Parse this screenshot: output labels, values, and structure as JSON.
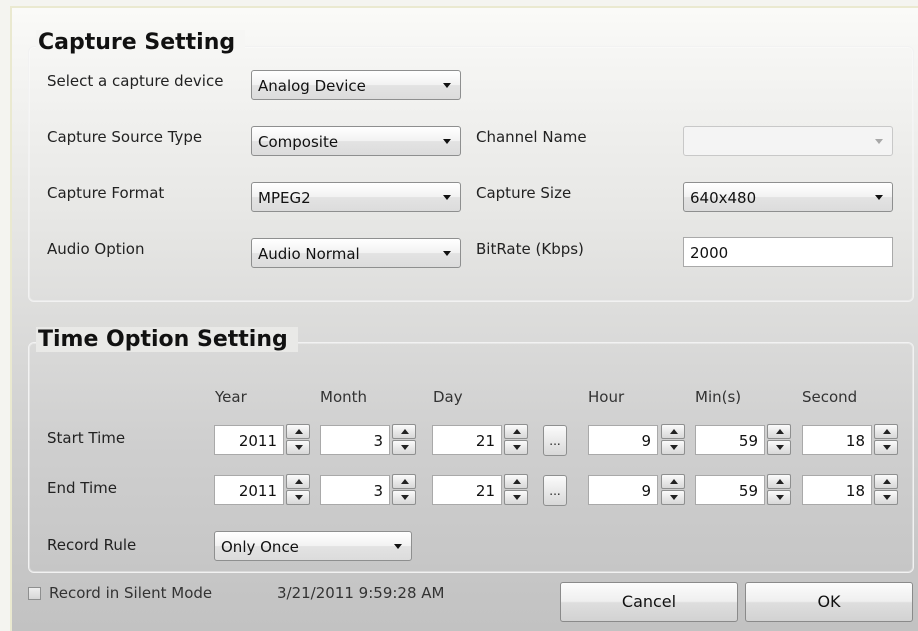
{
  "capture": {
    "title": "Capture Setting",
    "device_label": "Select a capture device",
    "device_value": "Analog Device",
    "source_type_label": "Capture Source Type",
    "source_type_value": "Composite",
    "channel_name_label": "Channel Name",
    "channel_name_value": "",
    "format_label": "Capture Format",
    "format_value": "MPEG2",
    "size_label": "Capture Size",
    "size_value": "640x480",
    "audio_label": "Audio Option",
    "audio_value": "Audio Normal",
    "bitrate_label": "BitRate (Kbps)",
    "bitrate_value": "2000"
  },
  "time": {
    "title": "Time Option Setting",
    "headers": {
      "year": "Year",
      "month": "Month",
      "day": "Day",
      "hour": "Hour",
      "min": "Min(s)",
      "second": "Second"
    },
    "start_label": "Start Time",
    "end_label": "End Time",
    "start": {
      "year": "2011",
      "month": "3",
      "day": "21",
      "hour": "9",
      "min": "59",
      "second": "18"
    },
    "end": {
      "year": "2011",
      "month": "3",
      "day": "21",
      "hour": "9",
      "min": "59",
      "second": "18"
    },
    "ellipsis_label": "...",
    "record_rule_label": "Record Rule",
    "record_rule_value": "Only Once"
  },
  "footer": {
    "silent_mode_label": "Record in Silent Mode",
    "silent_mode_checked": false,
    "timestamp": "3/21/2011 9:59:28 AM",
    "cancel_label": "Cancel",
    "ok_label": "OK"
  }
}
